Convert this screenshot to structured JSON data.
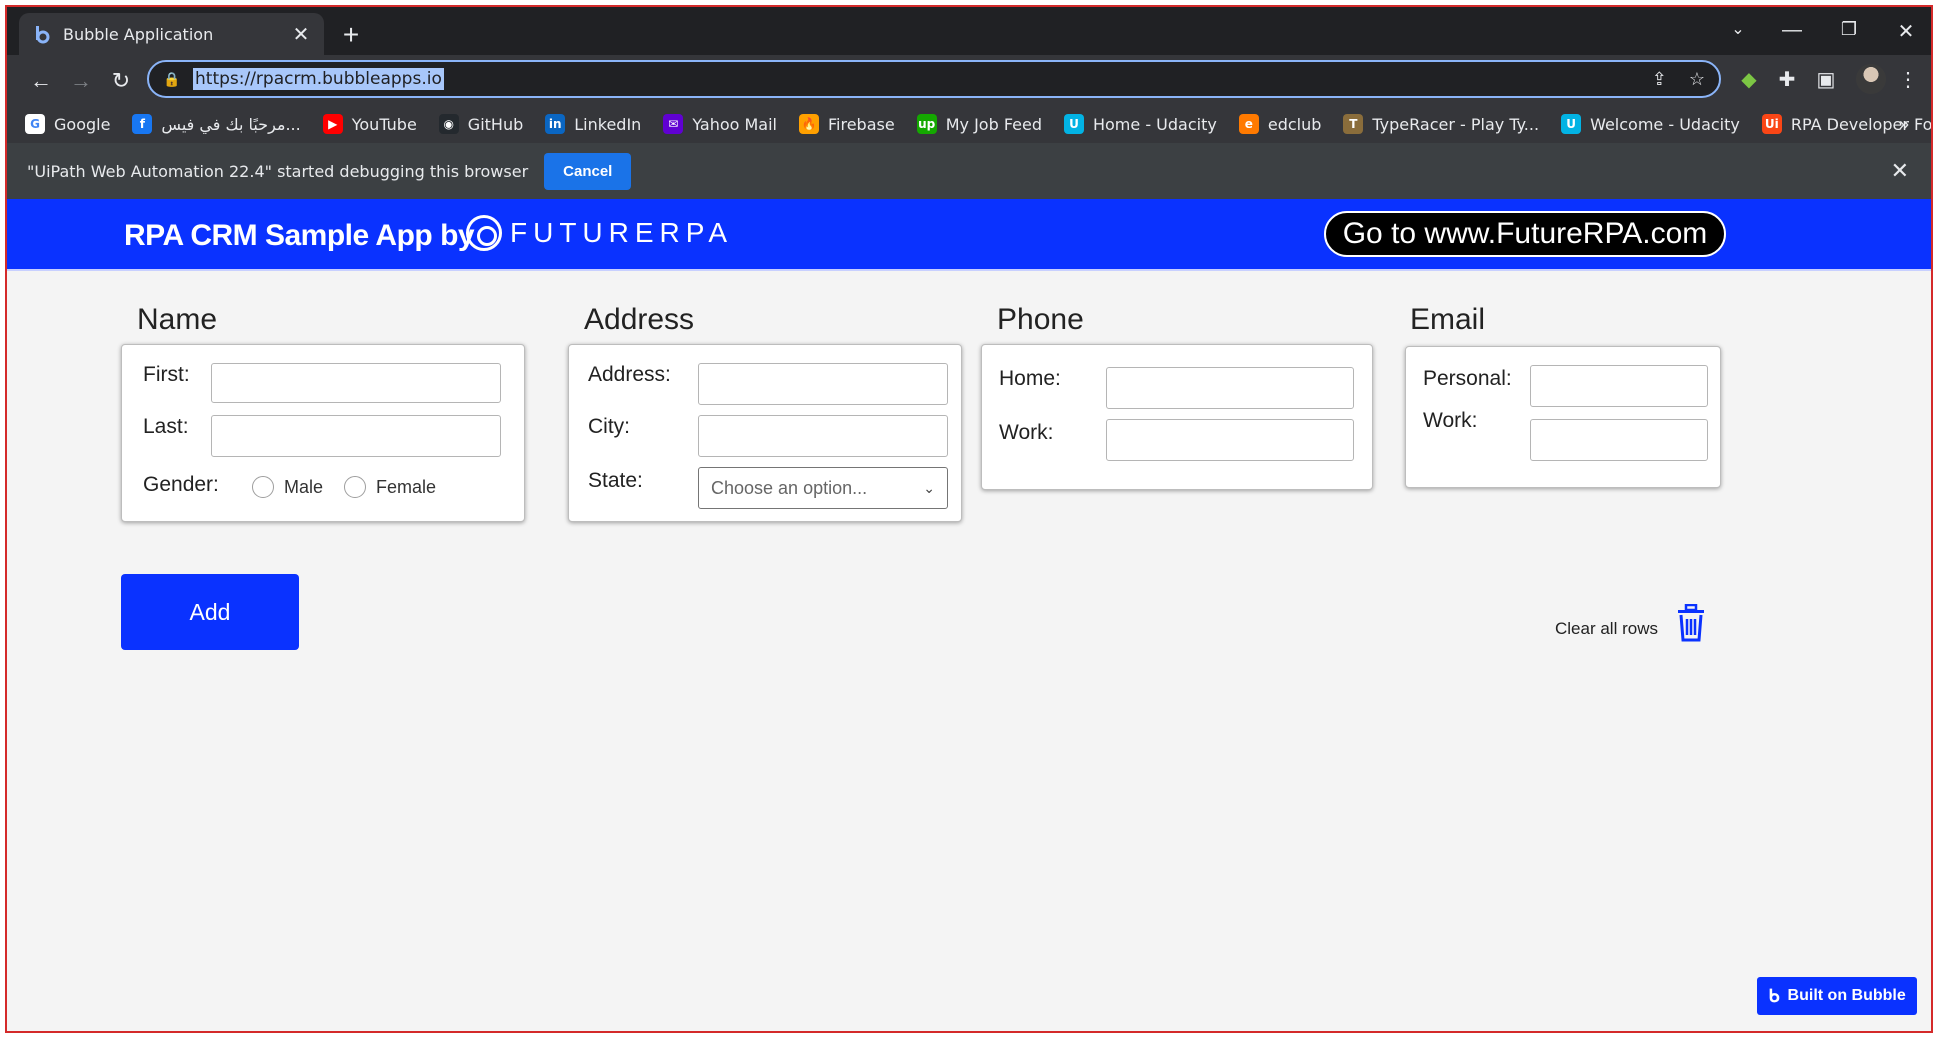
{
  "browser": {
    "tab_title": "Bubble Application",
    "url": "https://rpacrm.bubbleapps.io",
    "bookmarks": [
      {
        "label": "Google",
        "icon": "G",
        "color": "#ffffff"
      },
      {
        "label": "مرحبًا بك في فيس...",
        "icon": "f",
        "color": "#1877f2"
      },
      {
        "label": "YouTube",
        "icon": "▶",
        "color": "#ff0000"
      },
      {
        "label": "GitHub",
        "icon": "◉",
        "color": "#24292e"
      },
      {
        "label": "LinkedIn",
        "icon": "in",
        "color": "#0a66c2"
      },
      {
        "label": "Yahoo Mail",
        "icon": "✉",
        "color": "#6001d2"
      },
      {
        "label": "Firebase",
        "icon": "🔥",
        "color": "#ffa000"
      },
      {
        "label": "My Job Feed",
        "icon": "up",
        "color": "#14a800"
      },
      {
        "label": "Home - Udacity",
        "icon": "U",
        "color": "#02b3e4"
      },
      {
        "label": "edclub",
        "icon": "e",
        "color": "#ff7a00"
      },
      {
        "label": "TypeRacer - Play Ty...",
        "icon": "T",
        "color": "#8a6d3b"
      },
      {
        "label": "Welcome - Udacity",
        "icon": "U",
        "color": "#02b3e4"
      },
      {
        "label": "RPA Developer Fou...",
        "icon": "Ui",
        "color": "#fa4616"
      }
    ],
    "bookmarks_more": "»",
    "infobar_text": "\"UiPath Web Automation 22.4\" started debugging this browser",
    "infobar_cancel": "Cancel"
  },
  "app": {
    "title": "RPA CRM Sample App by",
    "logo_text": "FUTURERPA",
    "goto_label": "Go to www.FutureRPA.com"
  },
  "name_section": {
    "title": "Name",
    "first_label": "First:",
    "last_label": "Last:",
    "gender_label": "Gender:",
    "male_label": "Male",
    "female_label": "Female"
  },
  "address_section": {
    "title": "Address",
    "address_label": "Address:",
    "city_label": "City:",
    "state_label": "State:",
    "state_placeholder": "Choose an option..."
  },
  "phone_section": {
    "title": "Phone",
    "home_label": "Home:",
    "work_label": "Work:"
  },
  "email_section": {
    "title": "Email",
    "personal_label": "Personal:",
    "work_label": "Work:"
  },
  "actions": {
    "add_label": "Add",
    "clear_label": "Clear all rows"
  },
  "badge": {
    "label": "Built on Bubble"
  },
  "colors": {
    "accent": "#0a32ff",
    "frame_border": "#d42a2a"
  }
}
